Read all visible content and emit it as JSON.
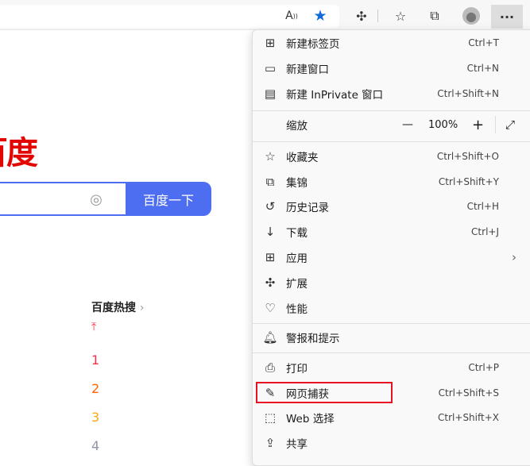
{
  "toolbar": {
    "icons": [
      "read-aloud-icon",
      "favorite-star-icon",
      "extensions-icon",
      "favorites-icon",
      "collections-icon",
      "profile-icon",
      "more-icon"
    ]
  },
  "page": {
    "logo": "百度",
    "search_button": "百度一下",
    "hot_title": "百度热搜",
    "hot_ranks": [
      "1",
      "2",
      "3",
      "4"
    ],
    "rank_colors": [
      "#fe2d46",
      "#f60",
      "#faa90e",
      "#9195a3"
    ]
  },
  "menu": {
    "items": [
      {
        "label": "新建标签页",
        "shortcut": "Ctrl+T",
        "icon": "new-tab-icon"
      },
      {
        "label": "新建窗口",
        "shortcut": "Ctrl+N",
        "icon": "new-window-icon"
      },
      {
        "label": "新建 InPrivate 窗口",
        "shortcut": "Ctrl+Shift+N",
        "icon": "inprivate-icon"
      },
      {
        "label": "收藏夹",
        "shortcut": "Ctrl+Shift+O",
        "icon": "favorites-icon"
      },
      {
        "label": "集锦",
        "shortcut": "Ctrl+Shift+Y",
        "icon": "collections-icon"
      },
      {
        "label": "历史记录",
        "shortcut": "Ctrl+H",
        "icon": "history-icon"
      },
      {
        "label": "下载",
        "shortcut": "Ctrl+J",
        "icon": "download-icon"
      },
      {
        "label": "应用",
        "shortcut": "",
        "icon": "apps-icon"
      },
      {
        "label": "扩展",
        "shortcut": "",
        "icon": "extensions-icon"
      },
      {
        "label": "性能",
        "shortcut": "",
        "icon": "performance-icon"
      },
      {
        "label": "警报和提示",
        "shortcut": "",
        "icon": "bell-icon"
      },
      {
        "label": "打印",
        "shortcut": "Ctrl+P",
        "icon": "print-icon"
      },
      {
        "label": "网页捕获",
        "shortcut": "Ctrl+Shift+S",
        "icon": "web-capture-icon"
      },
      {
        "label": "Web 选择",
        "shortcut": "Ctrl+Shift+X",
        "icon": "web-select-icon"
      },
      {
        "label": "共享",
        "shortcut": "",
        "icon": "share-icon"
      }
    ],
    "zoom": {
      "label": "缩放",
      "value": "100%",
      "minus": "—",
      "plus": "+"
    }
  }
}
